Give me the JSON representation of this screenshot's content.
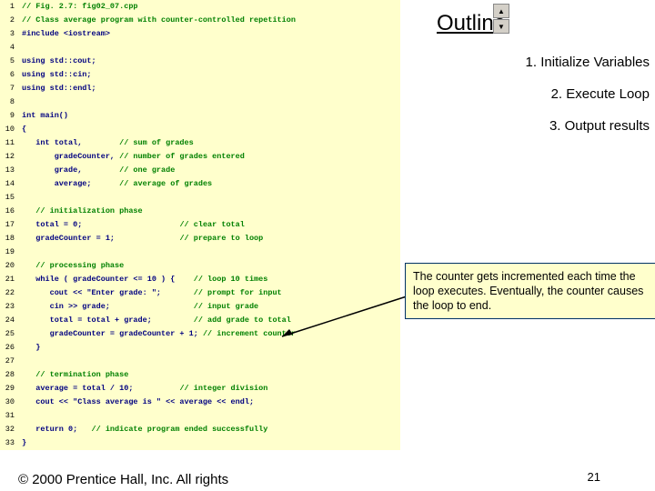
{
  "code": {
    "lines": [
      {
        "n": "1",
        "t": "// Fig. 2.7: fig02_07.cpp",
        "c": "cm"
      },
      {
        "n": "2",
        "t": "// Class average program with counter-controlled repetition",
        "c": "cm"
      },
      {
        "n": "3",
        "t": "#include <iostream>",
        "c": "inc"
      },
      {
        "n": "4",
        "t": "",
        "c": ""
      },
      {
        "n": "5",
        "t": "using std::cout;",
        "c": "kw"
      },
      {
        "n": "6",
        "t": "using std::cin;",
        "c": "kw"
      },
      {
        "n": "7",
        "t": "using std::endl;",
        "c": "kw"
      },
      {
        "n": "8",
        "t": "",
        "c": ""
      },
      {
        "n": "9",
        "t": "int main()",
        "c": "kw"
      },
      {
        "n": "10",
        "t": "{",
        "c": "kw"
      },
      {
        "n": "11",
        "t": "   int total,        // sum of grades",
        "c": "mix1"
      },
      {
        "n": "12",
        "t": "       gradeCounter, // number of grades entered",
        "c": "mix2"
      },
      {
        "n": "13",
        "t": "       grade,        // one grade",
        "c": "mix3"
      },
      {
        "n": "14",
        "t": "       average;      // average of grades",
        "c": "mix4"
      },
      {
        "n": "15",
        "t": "",
        "c": ""
      },
      {
        "n": "16",
        "t": "   // initialization phase",
        "c": "cm-indent"
      },
      {
        "n": "17",
        "t": "   total = 0;                     // clear total",
        "c": "mix5"
      },
      {
        "n": "18",
        "t": "   gradeCounter = 1;              // prepare to loop",
        "c": "mix6"
      },
      {
        "n": "19",
        "t": "",
        "c": ""
      },
      {
        "n": "20",
        "t": "   // processing phase",
        "c": "cm-indent"
      },
      {
        "n": "21",
        "t": "   while ( gradeCounter <= 10 ) {    // loop 10 times",
        "c": "mix7"
      },
      {
        "n": "22",
        "t": "      cout << \"Enter grade: \";       // prompt for input",
        "c": "mix8"
      },
      {
        "n": "23",
        "t": "      cin >> grade;                  // input grade",
        "c": "mix9"
      },
      {
        "n": "24",
        "t": "      total = total + grade;         // add grade to total",
        "c": "mix10"
      },
      {
        "n": "25",
        "t": "      gradeCounter = gradeCounter + 1; // increment counter",
        "c": "mix11"
      },
      {
        "n": "26",
        "t": "   }",
        "c": "kw"
      },
      {
        "n": "27",
        "t": "",
        "c": ""
      },
      {
        "n": "28",
        "t": "   // termination phase",
        "c": "cm-indent"
      },
      {
        "n": "29",
        "t": "   average = total / 10;          // integer division",
        "c": "mix12"
      },
      {
        "n": "30",
        "t": "   cout << \"Class average is \" << average << endl;",
        "c": "kw"
      },
      {
        "n": "31",
        "t": "",
        "c": ""
      },
      {
        "n": "32",
        "t": "   return 0;   // indicate program ended successfully",
        "c": "mix13"
      },
      {
        "n": "33",
        "t": "}",
        "c": "kw"
      }
    ]
  },
  "outline": {
    "title": "Outline",
    "items": [
      "1.  Initialize Variables",
      "2.  Execute Loop",
      "3.  Output results"
    ]
  },
  "callout": {
    "text": "The counter gets incremented each time the loop executes.  Eventually, the counter causes the loop to end."
  },
  "footer": {
    "copyright": "© 2000 Prentice Hall, Inc.  All rights",
    "page": "21"
  },
  "scroll": {
    "up": "▲",
    "down": "▼"
  }
}
